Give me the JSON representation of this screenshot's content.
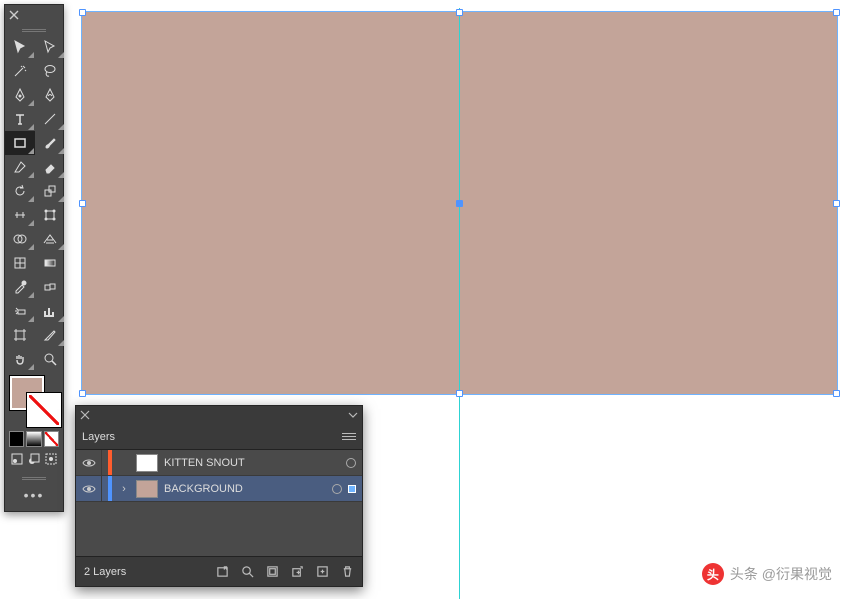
{
  "canvas": {
    "bg_color": "#c3a499"
  },
  "tools": {
    "items": [
      "selection",
      "direct-selection",
      "magic-wand",
      "lasso",
      "pen",
      "curvature",
      "type",
      "line-segment",
      "rectangle",
      "paintbrush",
      "shaper",
      "eraser",
      "rotate",
      "scale",
      "width",
      "free-transform",
      "shape-builder",
      "perspective-grid",
      "mesh",
      "gradient",
      "eyedropper",
      "blend",
      "symbol-sprayer",
      "column-graph",
      "artboard",
      "slice",
      "hand",
      "zoom"
    ]
  },
  "layers_panel": {
    "title": "Layers",
    "count_label": "2 Layers",
    "layers": [
      {
        "name": "KITTEN SNOUT",
        "color": "#ff5d2e",
        "thumb": "#ffffff",
        "selected": false,
        "expandable": false
      },
      {
        "name": "BACKGROUND",
        "color": "#4f94ff",
        "thumb": "#c3a499",
        "selected": true,
        "expandable": true
      }
    ]
  },
  "watermark": {
    "text": "头条 @衍果视觉"
  }
}
